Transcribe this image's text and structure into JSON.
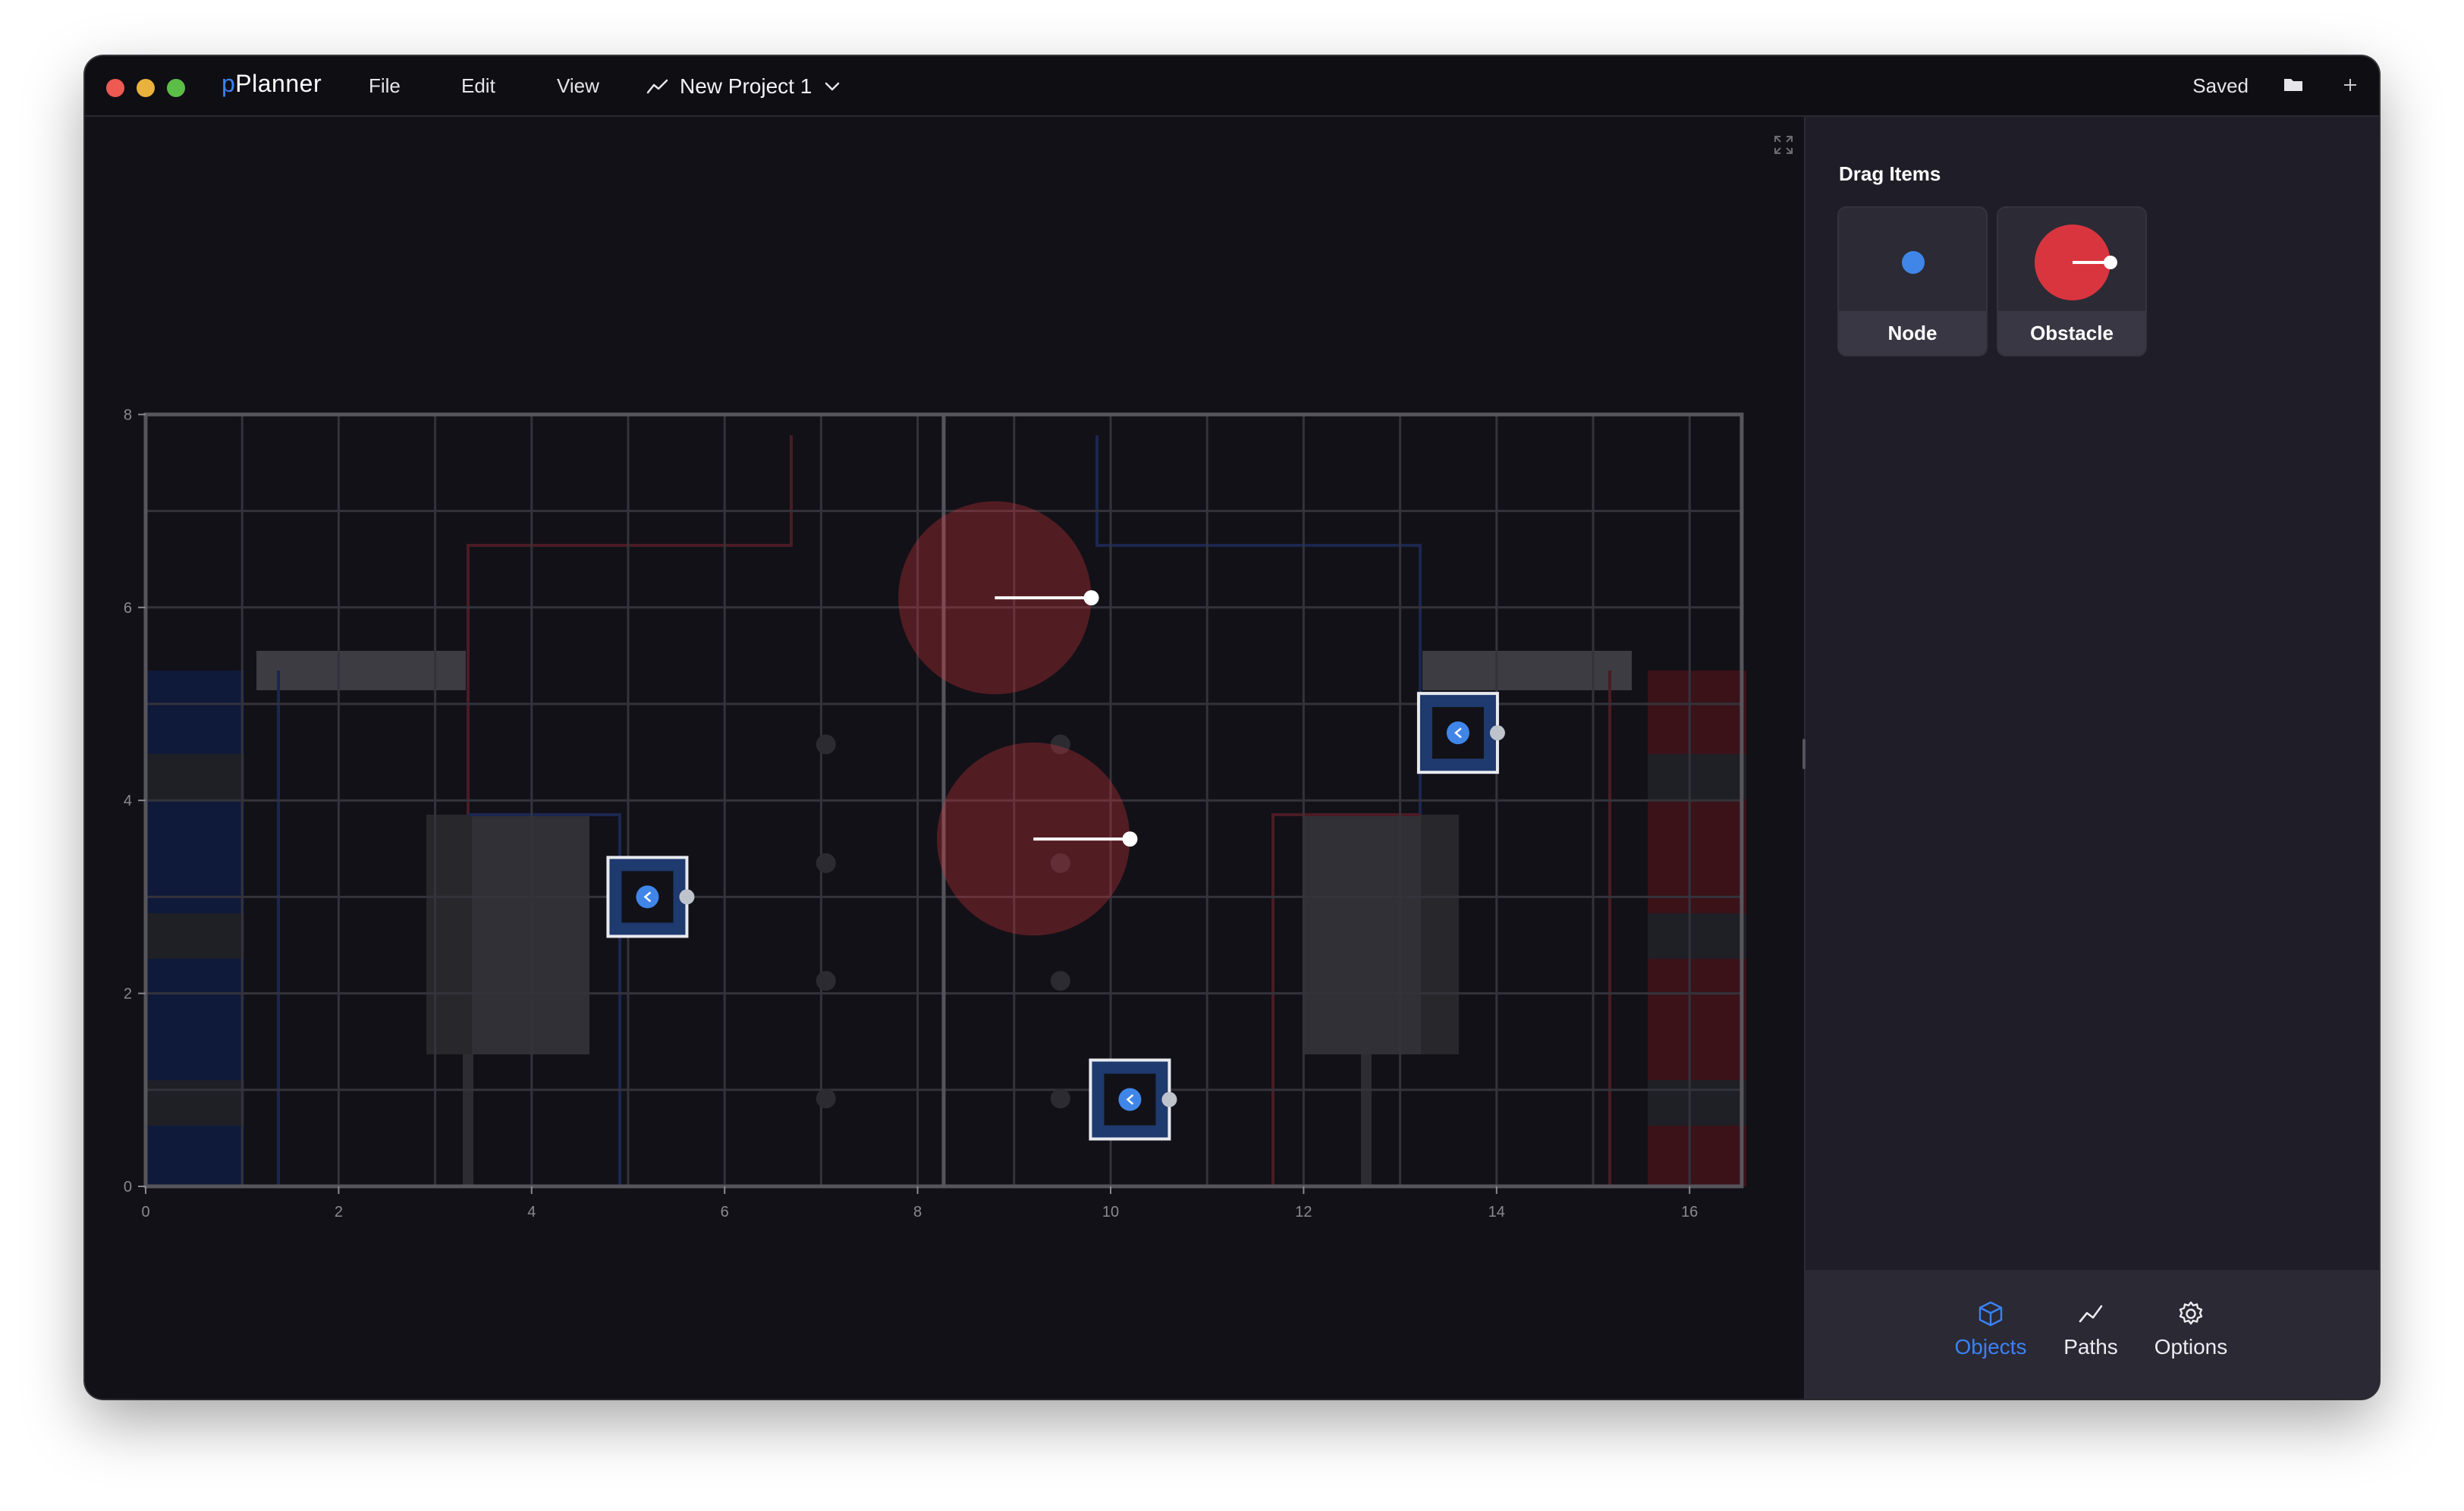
{
  "app": {
    "name_prefix": "p",
    "name_rest": "Planner"
  },
  "menu": {
    "file": "File",
    "edit": "Edit",
    "view": "View"
  },
  "project": {
    "name": "New Project 1"
  },
  "status": {
    "saved": "Saved"
  },
  "colors": {
    "accent": "#3b82f6",
    "obstacle": "#d9353f",
    "blue_alliance": "#0f1a3a",
    "red_alliance": "#3a1218",
    "node": "#3f86e8"
  },
  "field": {
    "x_tick_labels": [
      "0",
      "2",
      "4",
      "6",
      "8",
      "10",
      "12",
      "14",
      "16"
    ],
    "y_tick_labels": [
      "0",
      "2",
      "4",
      "6",
      "8"
    ],
    "x_range": [
      0,
      16.54
    ],
    "y_range": [
      0,
      8
    ]
  },
  "obstacles": [
    {
      "x": 8.8,
      "y": 6.1,
      "radius": 1.0
    },
    {
      "x": 9.2,
      "y": 3.6,
      "radius": 1.0
    }
  ],
  "robots": [
    {
      "x": 5.2,
      "y": 3.0
    },
    {
      "x": 13.6,
      "y": 4.7
    },
    {
      "x": 10.2,
      "y": 0.9
    }
  ],
  "sidebar": {
    "drag_title": "Drag Items",
    "items": [
      {
        "label": "Node",
        "icon": "node-icon"
      },
      {
        "label": "Obstacle",
        "icon": "obstacle-icon"
      }
    ]
  },
  "bottom_nav": {
    "tabs": [
      {
        "label": "Objects",
        "icon": "cube-icon",
        "active": true
      },
      {
        "label": "Paths",
        "icon": "paths-icon",
        "active": false
      },
      {
        "label": "Options",
        "icon": "gear-icon",
        "active": false
      }
    ]
  }
}
